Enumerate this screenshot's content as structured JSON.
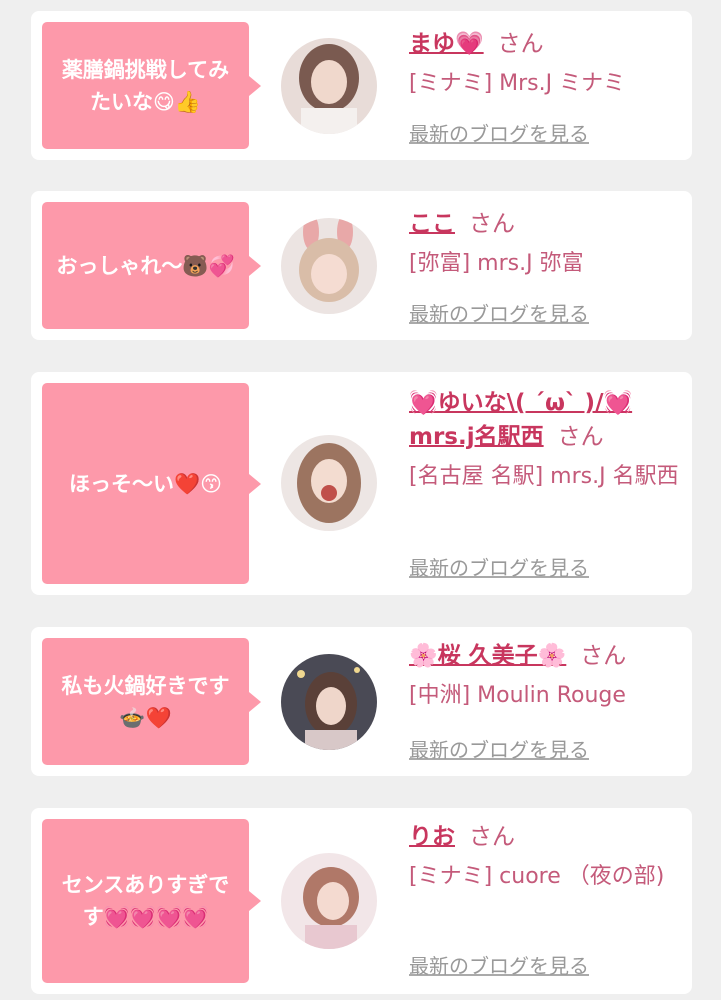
{
  "blog_link_label": "最新のブログを見る",
  "honorific": "さん",
  "entries": [
    {
      "comment": "薬膳鍋挑戦してみたいな😋👍",
      "name": "まゆ💗",
      "shop": "[ミナミ] Mrs.J ミナミ",
      "avatar_tone": "#c9a7a2"
    },
    {
      "comment": "おっしゃれ〜🐻💞",
      "name": "ここ",
      "shop": "[弥富] mrs.J 弥富",
      "avatar_tone": "#d8b8b0"
    },
    {
      "comment": "ほっそ〜い❤️😙",
      "name": "💓ゆいな\\( ´ω` )/💓mrs.j名駅西",
      "shop": "[名古屋 名駅] mrs.J 名駅西",
      "avatar_tone": "#b89484"
    },
    {
      "comment": "私も火鍋好きです🍲❤️",
      "name": "🌸桜 久美子🌸",
      "shop": "[中洲] Moulin Rouge",
      "avatar_tone": "#6d6a73"
    },
    {
      "comment": "センスありすぎです💓💓💓💓",
      "name": "りお",
      "shop": "[ミナミ] cuore （夜の部)",
      "avatar_tone": "#c28f86"
    }
  ]
}
